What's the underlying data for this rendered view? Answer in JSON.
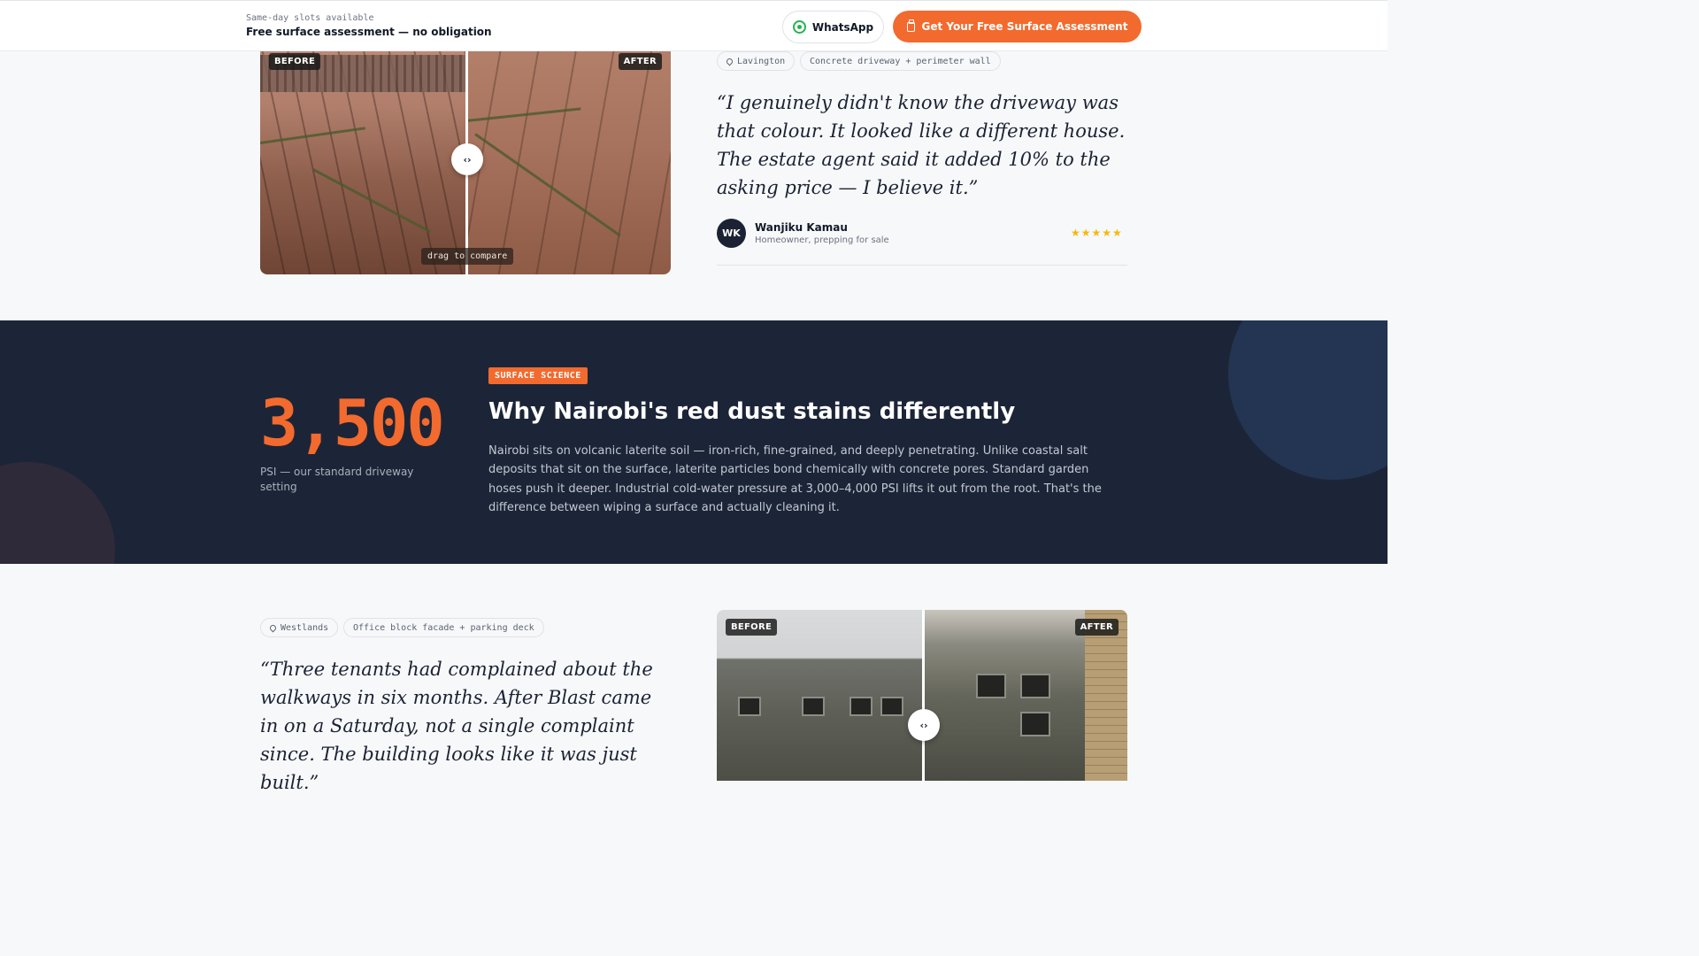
{
  "topbar": {
    "kicker": "Same-day slots available",
    "headline": "Free surface assessment — no obligation",
    "whatsapp_label": "WhatsApp",
    "cta_label": "Get Your Free Surface Assessment"
  },
  "case1": {
    "before_tag": "BEFORE",
    "after_tag": "AFTER",
    "drag_hint": "drag to compare",
    "location": "Lavington",
    "scope": "Concrete driveway + perimeter wall",
    "quote": "“I genuinely didn't know the driveway was that colour. It looked like a different house. The estate agent said it added 10% to the asking price — I believe it.”",
    "author_initials": "WK",
    "author_name": "Wanjiku Kamau",
    "author_role": "Homeowner, prepping for sale",
    "stars": "★★★★★"
  },
  "science": {
    "big_number": "3,500",
    "number_caption": "PSI — our standard driveway setting",
    "badge": "SURFACE SCIENCE",
    "title": "Why Nairobi's red dust stains differently",
    "body": "Nairobi sits on volcanic laterite soil — iron-rich, fine-grained, and deeply penetrating. Unlike coastal salt deposits that sit on the surface, laterite particles bond chemically with concrete pores. Standard garden hoses push it deeper. Industrial cold-water pressure at 3,000–4,000 PSI lifts it out from the root. That's the difference between wiping a surface and actually cleaning it."
  },
  "case2": {
    "before_tag": "BEFORE",
    "after_tag": "AFTER",
    "location": "Westlands",
    "scope": "Office block facade + parking deck",
    "quote": "“Three tenants had complained about the walkways in six months. After Blast came in on a Saturday, not a single complaint since. The building looks like it was just built.”"
  },
  "icons": {
    "handle_glyph": "‹›",
    "colors": {
      "accent": "#f26a2e",
      "dark_band": "#1c2537",
      "star": "#f5b90a"
    }
  }
}
